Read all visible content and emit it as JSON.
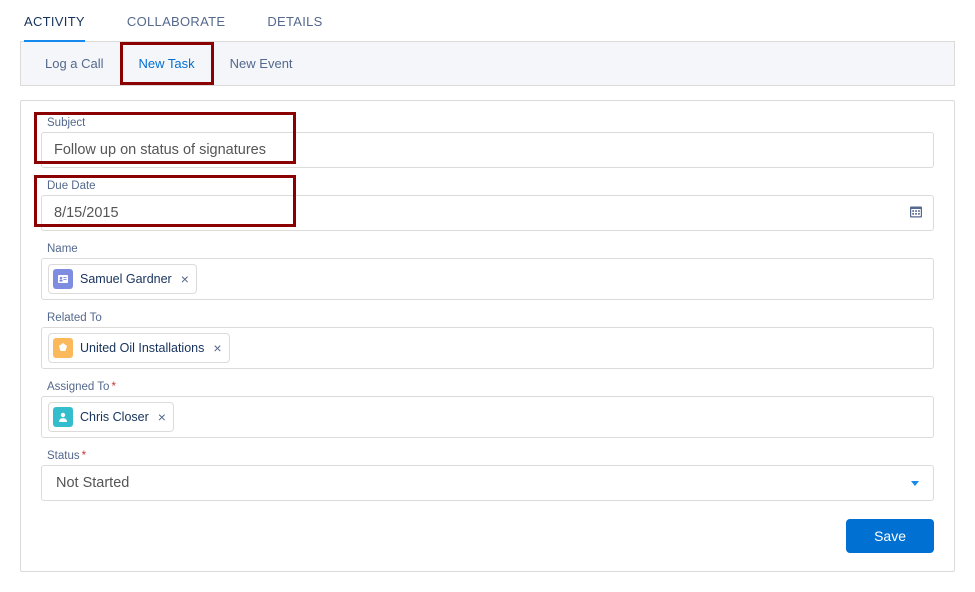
{
  "top_tabs": {
    "activity": "ACTIVITY",
    "collaborate": "COLLABORATE",
    "details": "DETAILS"
  },
  "sub_tabs": {
    "log_a_call": "Log a Call",
    "new_task": "New Task",
    "new_event": "New Event"
  },
  "form": {
    "subject": {
      "label": "Subject",
      "value": "Follow up on status of signatures"
    },
    "due_date": {
      "label": "Due Date",
      "value": "8/15/2015"
    },
    "name": {
      "label": "Name",
      "pill": {
        "text": "Samuel Gardner",
        "icon": "contact"
      }
    },
    "related_to": {
      "label": "Related To",
      "pill": {
        "text": "United Oil Installations",
        "icon": "opportunity"
      }
    },
    "assigned_to": {
      "label": "Assigned To",
      "required_mark": "*",
      "pill": {
        "text": "Chris Closer",
        "icon": "user"
      }
    },
    "status": {
      "label": "Status",
      "required_mark": "*",
      "value": "Not Started"
    }
  },
  "actions": {
    "save": "Save"
  }
}
